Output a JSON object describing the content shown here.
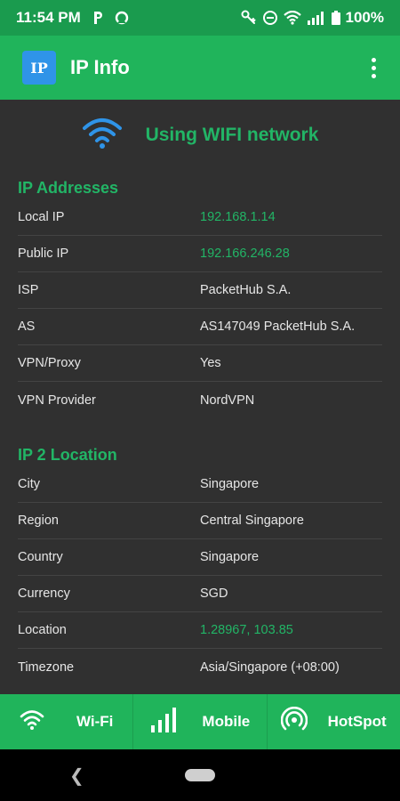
{
  "status_bar": {
    "time": "11:54 PM",
    "battery": "100%",
    "left_icons": [
      "p-notification-icon",
      "sync-icon"
    ],
    "right_icons": [
      "key-icon",
      "dnd-icon",
      "wifi-icon",
      "signal-icon",
      "battery-icon"
    ]
  },
  "app_bar": {
    "logo": "IP",
    "title": "IP Info",
    "menu_icon": "overflow-menu-icon"
  },
  "network": {
    "icon": "wifi-icon",
    "label": "Using WIFI network"
  },
  "ip_addresses": {
    "title": "IP Addresses",
    "rows": [
      {
        "key": "Local IP",
        "value": "192.168.1.14"
      },
      {
        "key": "Public IP",
        "value": "192.166.246.28"
      },
      {
        "key": "ISP",
        "value": "PacketHub S.A."
      },
      {
        "key": "AS",
        "value": "AS147049 PacketHub S.A."
      },
      {
        "key": "VPN/Proxy",
        "value": "Yes"
      },
      {
        "key": "VPN Provider",
        "value": "NordVPN"
      }
    ]
  },
  "ip_location": {
    "title": "IP 2 Location",
    "rows": [
      {
        "key": "City",
        "value": "Singapore"
      },
      {
        "key": "Region",
        "value": "Central Singapore"
      },
      {
        "key": "Country",
        "value": "Singapore"
      },
      {
        "key": "Currency",
        "value": "SGD"
      },
      {
        "key": "Location",
        "value": "1.28967, 103.85"
      },
      {
        "key": "Timezone",
        "value": "Asia/Singapore (+08:00)"
      }
    ]
  },
  "bottom_nav": {
    "items": [
      {
        "label": "Wi-Fi",
        "icon": "wifi-icon"
      },
      {
        "label": "Mobile",
        "icon": "signal-bars-icon"
      },
      {
        "label": "HotSpot",
        "icon": "hotspot-icon"
      }
    ]
  },
  "colors": {
    "primary": "#20b45b",
    "status_bar": "#1a9b4e",
    "accent_text": "#22b566",
    "background": "#303030",
    "logo_bg": "#2f94e8",
    "network_icon": "#2f94e8"
  }
}
